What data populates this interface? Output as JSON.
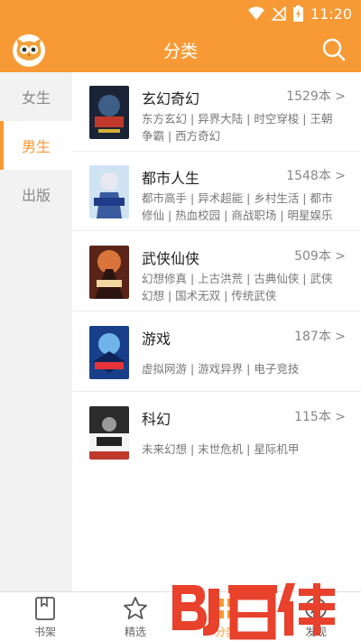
{
  "status_bar": {
    "time": "11:20"
  },
  "header": {
    "title": "分类",
    "search_icon": "search-icon",
    "avatar_icon": "owl-avatar"
  },
  "sidebar": {
    "items": [
      {
        "label": "女生",
        "active": false
      },
      {
        "label": "男生",
        "active": true
      },
      {
        "label": "出版",
        "active": false
      }
    ]
  },
  "categories": [
    {
      "name": "玄幻奇幻",
      "count": "1529本 >",
      "subs": "东方玄幻 | 异界大陆 | 时空穿梭 | 王朝争霸 | 西方奇幻"
    },
    {
      "name": "都市人生",
      "count": "1548本 >",
      "subs": "都市高手 | 异术超能 | 乡村生活 | 都市修仙 | 热血校园 | 商战职场 | 明星娱乐"
    },
    {
      "name": "武侠仙侠",
      "count": "509本 >",
      "subs": "幻想修真 | 上古洪荒 | 古典仙侠 | 武侠幻想 | 国术无双 | 传统武侠"
    },
    {
      "name": "游戏",
      "count": "187本 >",
      "subs": "虚拟网游 | 游戏异界 | 电子竞技"
    },
    {
      "name": "科幻",
      "count": "115本 >",
      "subs": "未来幻想 | 末世危机 | 星际机甲"
    }
  ],
  "bottom_nav": {
    "items": [
      {
        "label": "书架",
        "icon": "bookshelf-icon",
        "active": false
      },
      {
        "label": "精选",
        "icon": "star-icon",
        "active": false
      },
      {
        "label": "分类",
        "icon": "category-icon",
        "active": true
      },
      {
        "label": "发现",
        "icon": "discover-icon",
        "active": false
      }
    ]
  },
  "watermark": {
    "text": "BJ百佳"
  },
  "colors": {
    "accent": "#f79a35",
    "divider": "#ececec",
    "sidebar_bg": "#f2f2f2"
  }
}
